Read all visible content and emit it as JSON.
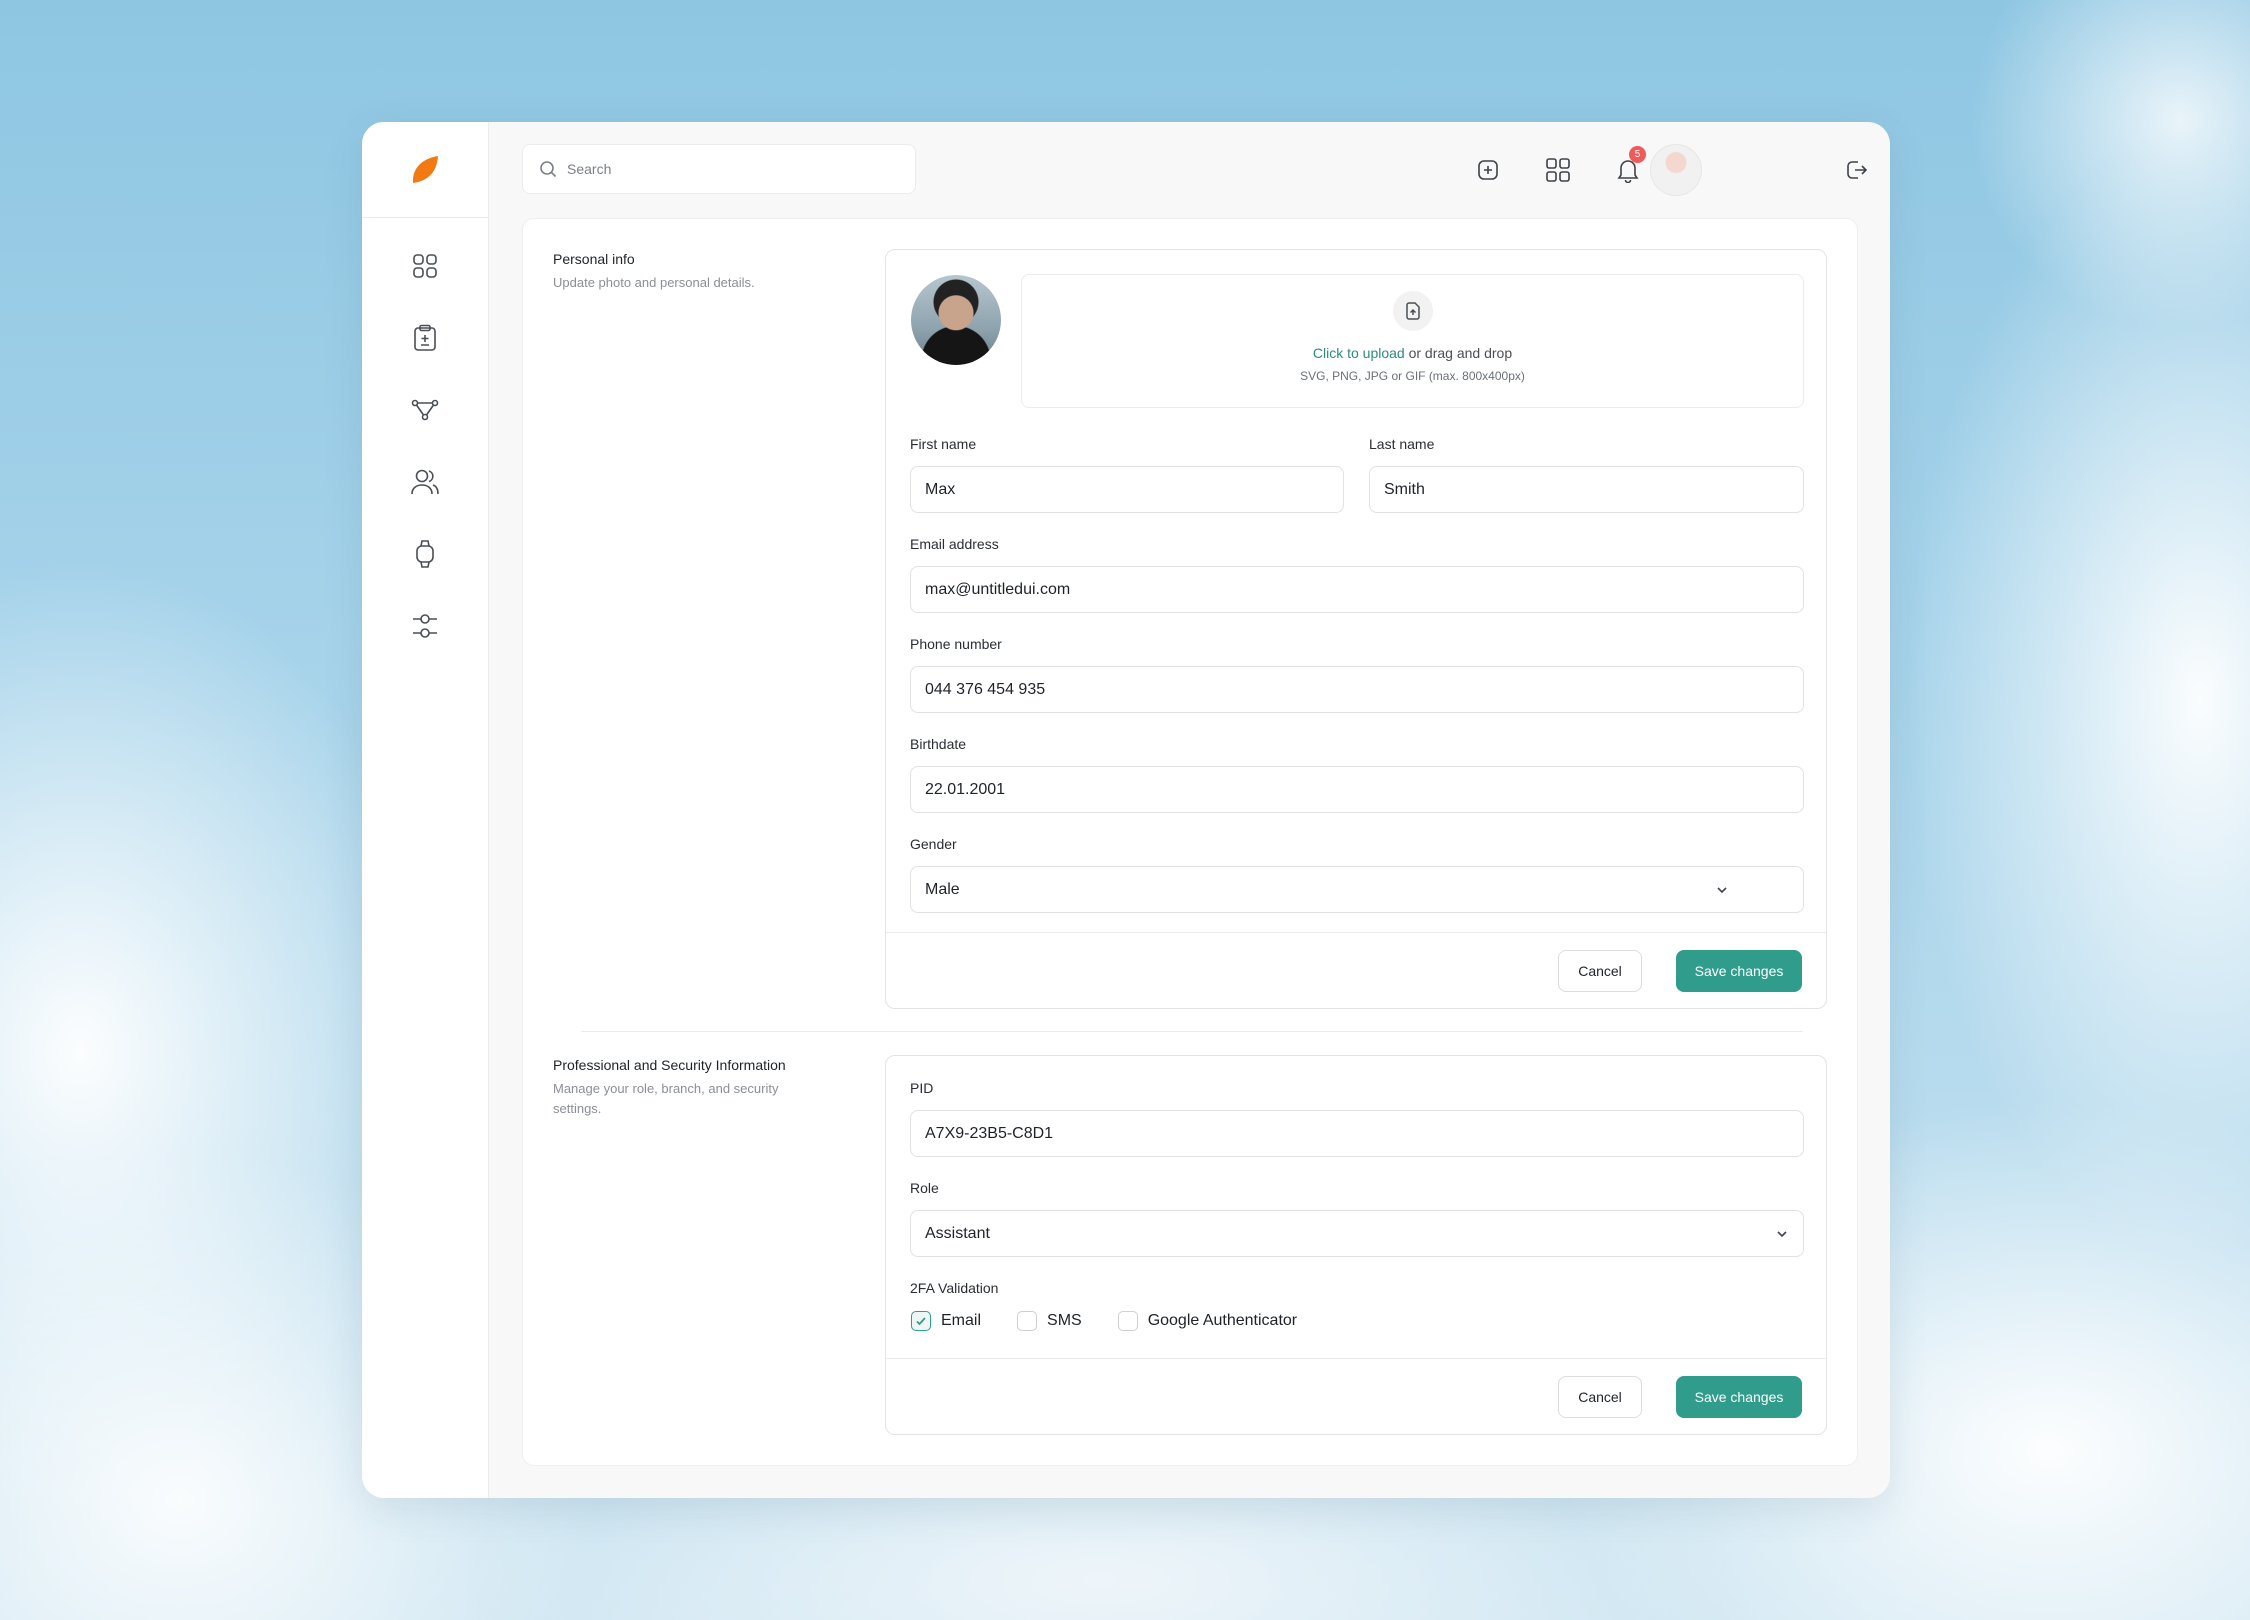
{
  "theme": {
    "accent": "#2f9c8c",
    "logo_color": "#f27a14",
    "notification_color": "#ef5a5a"
  },
  "sidebar": {
    "items": [
      {
        "icon": "dashboard-grid-icon"
      },
      {
        "icon": "clipboard-icon"
      },
      {
        "icon": "workflow-nodes-icon"
      },
      {
        "icon": "users-icon"
      },
      {
        "icon": "watch-icon"
      },
      {
        "icon": "settings-sliders-icon"
      }
    ]
  },
  "topbar": {
    "search_placeholder": "Search",
    "notification_count": "5",
    "icons": [
      "add-square-icon",
      "apps-grid-icon",
      "bell-icon",
      "sun-icon",
      "avatar",
      "logout-icon"
    ]
  },
  "personal": {
    "title": "Personal info",
    "description": "Update photo and personal details.",
    "upload": {
      "link_text": "Click to upload",
      "rest_text": " or drag and drop",
      "hint": "SVG, PNG, JPG or GIF (max. 800x400px)"
    },
    "first_name_label": "First name",
    "first_name": "Max",
    "last_name_label": "Last name",
    "last_name": "Smith",
    "email_label": "Email address",
    "email": "max@untitledui.com",
    "phone_label": "Phone number",
    "phone": "044 376 454 935",
    "birthdate_label": "Birthdate",
    "birthdate": "22.01.2001",
    "gender_label": "Gender",
    "gender": "Male",
    "cancel": "Cancel",
    "save": "Save changes"
  },
  "professional": {
    "title": "Professional and Security Information",
    "description": "Manage your role, branch, and security settings.",
    "pid_label": "PID",
    "pid": "A7X9-23B5-C8D1",
    "role_label": "Role",
    "role": "Assistant",
    "twofa_label": "2FA Validation",
    "twofa_options": [
      {
        "label": "Email",
        "checked": true
      },
      {
        "label": "SMS",
        "checked": false
      },
      {
        "label": "Google Authenticator",
        "checked": false
      }
    ],
    "cancel": "Cancel",
    "save": "Save changes"
  }
}
